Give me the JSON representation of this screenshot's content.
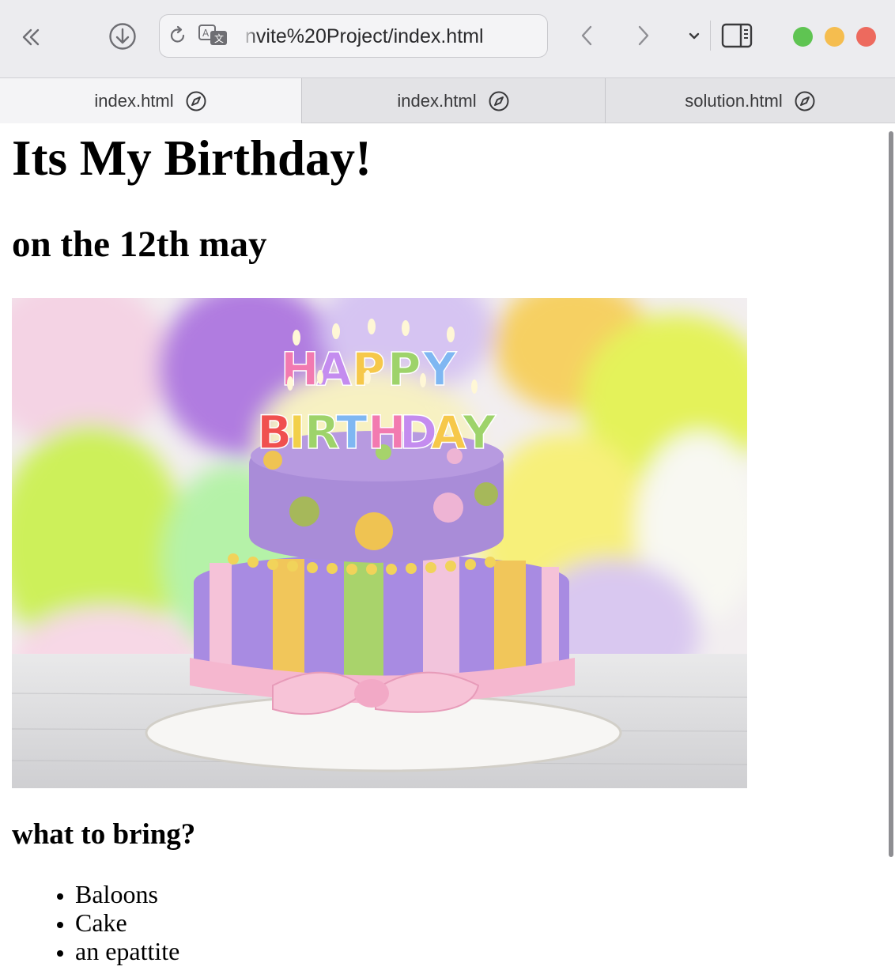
{
  "browser": {
    "url": "nvite%20Project/index.html",
    "tabs": [
      {
        "label": "index.html",
        "active": true
      },
      {
        "label": "index.html",
        "active": false
      },
      {
        "label": "solution.html",
        "active": false
      }
    ],
    "traffic_lights": {
      "green": "#5fc452",
      "yellow": "#f5bd4f",
      "red": "#ed6a5e"
    }
  },
  "page": {
    "title": "Its My Birthday!",
    "date": "on the 12th may",
    "image": {
      "icon": "birthday-cake-image",
      "cake_text_top": "HAPPY",
      "cake_text_bottom": "BIRTHDAY"
    },
    "bring_heading": "what to bring?",
    "bring_items": [
      "Baloons",
      "Cake",
      "an epattite"
    ]
  }
}
